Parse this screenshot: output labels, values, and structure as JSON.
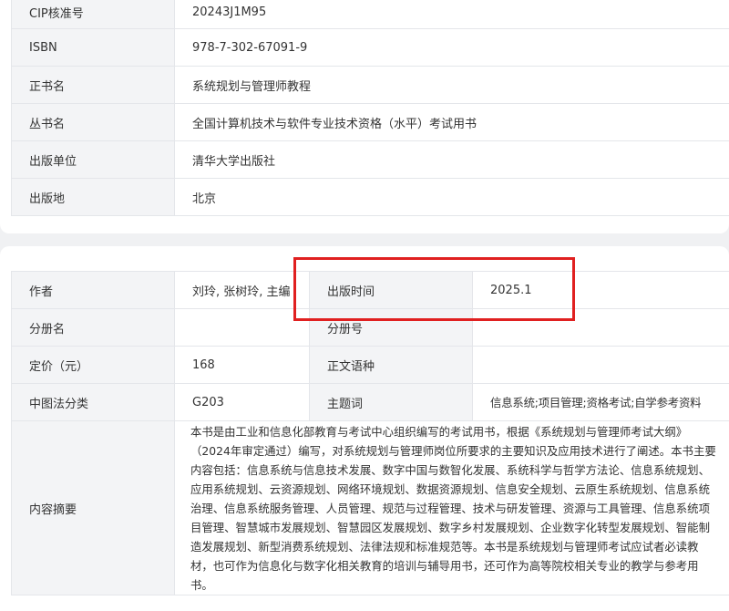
{
  "basic_info": {
    "rows": [
      {
        "label": "CIP核准号",
        "value": "20243J1M95"
      },
      {
        "label": "ISBN",
        "value": "978-7-302-67091-9"
      },
      {
        "label": "正书名",
        "value": "系统规划与管理师教程"
      },
      {
        "label": "丛书名",
        "value": "全国计算机技术与软件专业技术资格（水平）考试用书"
      },
      {
        "label": "出版单位",
        "value": "清华大学出版社"
      },
      {
        "label": "出版地",
        "value": "北京"
      }
    ]
  },
  "detail_info": {
    "author_label": "作者",
    "author_value": "刘玲, 张树玲, 主编",
    "pub_date_label": "出版时间",
    "pub_date_value": "2025.1",
    "volume_name_label": "分册名",
    "volume_name_value": "",
    "volume_no_label": "分册号",
    "volume_no_value": "",
    "price_label": "定价（元）",
    "price_value": "168",
    "language_label": "正文语种",
    "language_value": "",
    "clc_label": "中图法分类",
    "clc_value": "G203",
    "subject_label": "主题词",
    "subject_value": "信息系统;项目管理;资格考试;自学参考资料",
    "summary_label": "内容摘要",
    "summary_value": "本书是由工业和信息化部教育与考试中心组织编写的考试用书，根据《系统规划与管理师考试大纲》（2024年审定通过）编写，对系统规划与管理师岗位所要求的主要知识及应用技术进行了阐述。本书主要内容包括：信息系统与信息技术发展、数字中国与数智化发展、系统科学与哲学方法论、信息系统规划、应用系统规划、云资源规划、网络环境规划、数据资源规划、信息安全规划、云原生系统规划、信息系统治理、信息系统服务管理、人员管理、规范与过程管理、技术与研发管理、资源与工具管理、信息系统项目管理、智慧城市发展规划、智慧园区发展规划、数字乡村发展规划、企业数字化转型发展规划、智能制造发展规划、新型消费系统规划、法律法规和标准规范等。本书是系统规划与管理师考试应试者必读教材，也可作为信息化与数字化相关教育的培训与辅导用书，还可作为高等院校相关专业的教学与参考用书。"
  },
  "colors": {
    "highlight": "#e02020",
    "label_bg": "#f3f4f6",
    "border": "#e4e6ea",
    "page_bg": "#f0f1f3"
  }
}
